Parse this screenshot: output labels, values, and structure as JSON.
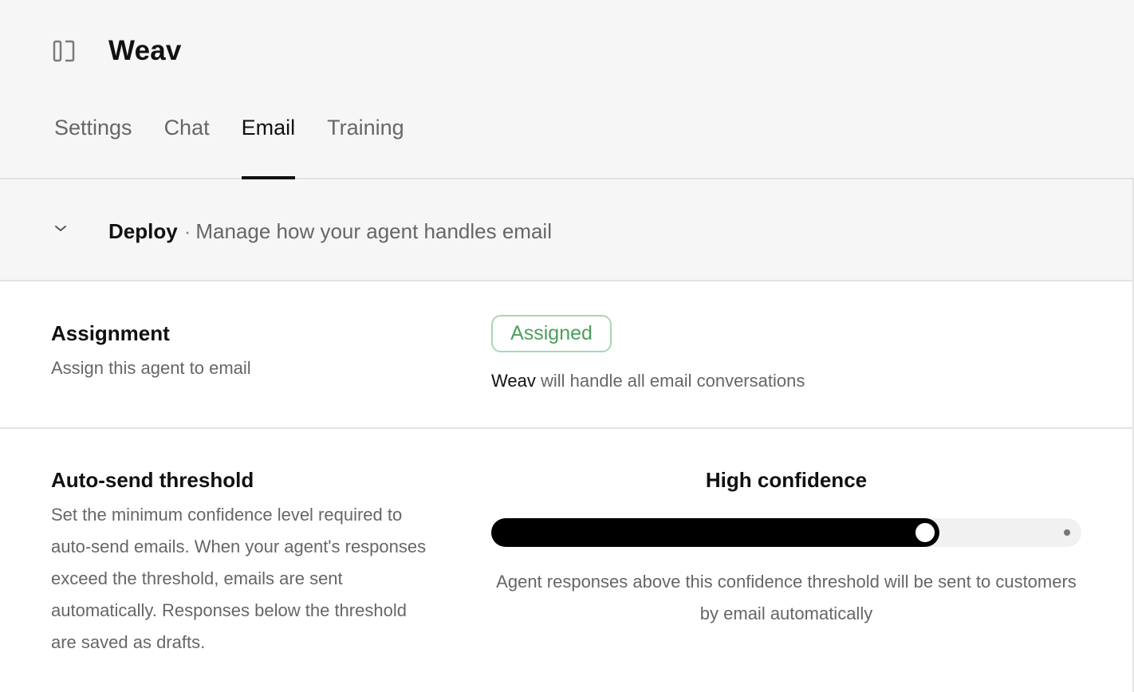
{
  "header": {
    "app_title": "Weav",
    "sidebar_toggle_icon": "sidebar-toggle-icon",
    "tabs": [
      {
        "label": "Settings",
        "active": false
      },
      {
        "label": "Chat",
        "active": false
      },
      {
        "label": "Email",
        "active": true
      },
      {
        "label": "Training",
        "active": false
      }
    ]
  },
  "deploy": {
    "icon": "chevron-down-icon",
    "title": "Deploy",
    "separator": "·",
    "description": "Manage how your agent handles email"
  },
  "assignment": {
    "title": "Assignment",
    "description": "Assign this agent to email",
    "status_label": "Assigned",
    "note_agent": "Weav",
    "note_text": " will handle all email conversations"
  },
  "threshold": {
    "title": "Auto-send threshold",
    "description": "Set the minimum confidence level required to auto-send emails. When your agent's responses exceed the threshold, emails are sent automatically. Responses below the threshold are saved as drafts.",
    "level_label": "High confidence",
    "level_value": 0.76,
    "note": "Agent responses above this confidence threshold will be sent to customers by email automatically"
  },
  "colors": {
    "accent": "#000000",
    "badge_text": "#4a9f5a",
    "badge_border": "#a9d6b1",
    "header_bg": "#f6f6f6",
    "muted_text": "#666666"
  }
}
